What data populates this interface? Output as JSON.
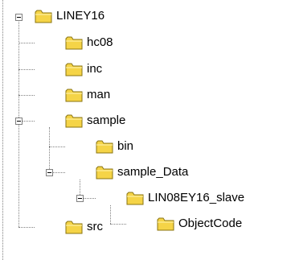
{
  "tree": {
    "nodes": [
      {
        "id": "node-liney16",
        "label": "LINEY16",
        "expanded": true
      },
      {
        "id": "node-hc08",
        "label": "hc08"
      },
      {
        "id": "node-inc",
        "label": "inc"
      },
      {
        "id": "node-man",
        "label": "man"
      },
      {
        "id": "node-sample",
        "label": "sample",
        "expanded": true
      },
      {
        "id": "node-bin",
        "label": "bin"
      },
      {
        "id": "node-sample-data",
        "label": "sample_Data",
        "expanded": true
      },
      {
        "id": "node-lin08ey16-slave",
        "label": "LIN08EY16_slave",
        "expanded": true
      },
      {
        "id": "node-objectcode",
        "label": "ObjectCode"
      },
      {
        "id": "node-src",
        "label": "src"
      }
    ],
    "icon": "folder-icon",
    "colors": {
      "folder": "#f5d447",
      "folder_dark": "#b89a1a",
      "line": "#808080"
    }
  }
}
